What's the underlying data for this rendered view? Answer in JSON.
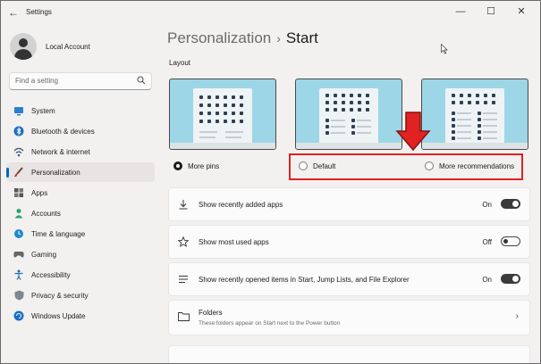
{
  "window": {
    "title": "Settings",
    "controls": {
      "minimize": "—",
      "maximize": "☐",
      "close": "✕"
    }
  },
  "sidebar": {
    "account": "Local Account",
    "search": {
      "placeholder": "Find a setting"
    },
    "items": [
      {
        "label": "System",
        "icon": "monitor-icon",
        "active": false
      },
      {
        "label": "Bluetooth & devices",
        "icon": "bluetooth-icon",
        "active": false
      },
      {
        "label": "Network & internet",
        "icon": "wifi-icon",
        "active": false
      },
      {
        "label": "Personalization",
        "icon": "brush-icon",
        "active": true
      },
      {
        "label": "Apps",
        "icon": "apps-icon",
        "active": false
      },
      {
        "label": "Accounts",
        "icon": "person-icon",
        "active": false
      },
      {
        "label": "Time & language",
        "icon": "globe-clock-icon",
        "active": false
      },
      {
        "label": "Gaming",
        "icon": "gamepad-icon",
        "active": false
      },
      {
        "label": "Accessibility",
        "icon": "accessibility-icon",
        "active": false
      },
      {
        "label": "Privacy & security",
        "icon": "shield-icon",
        "active": false
      },
      {
        "label": "Windows Update",
        "icon": "update-icon",
        "active": false
      }
    ]
  },
  "header": {
    "crumb": "Personalization",
    "separator": "›",
    "current": "Start"
  },
  "layout": {
    "label": "Layout",
    "options": [
      {
        "label": "More pins",
        "selected": true
      },
      {
        "label": "Default",
        "selected": false
      },
      {
        "label": "More recommendations",
        "selected": false
      }
    ]
  },
  "settings": [
    {
      "label": "Show recently added apps",
      "state": "On",
      "on": true,
      "icon": "download-icon"
    },
    {
      "label": "Show most used apps",
      "state": "Off",
      "on": false,
      "icon": "star-icon"
    },
    {
      "label": "Show recently opened items in Start, Jump Lists, and File Explorer",
      "state": "On",
      "on": true,
      "icon": "list-icon"
    }
  ],
  "folders": {
    "title": "Folders",
    "subtitle": "These folders appear on Start next to the Power button"
  },
  "colors": {
    "accent": "#0067c0",
    "highlight": "#e02222",
    "thumb_bg": "#9dd6e7"
  }
}
